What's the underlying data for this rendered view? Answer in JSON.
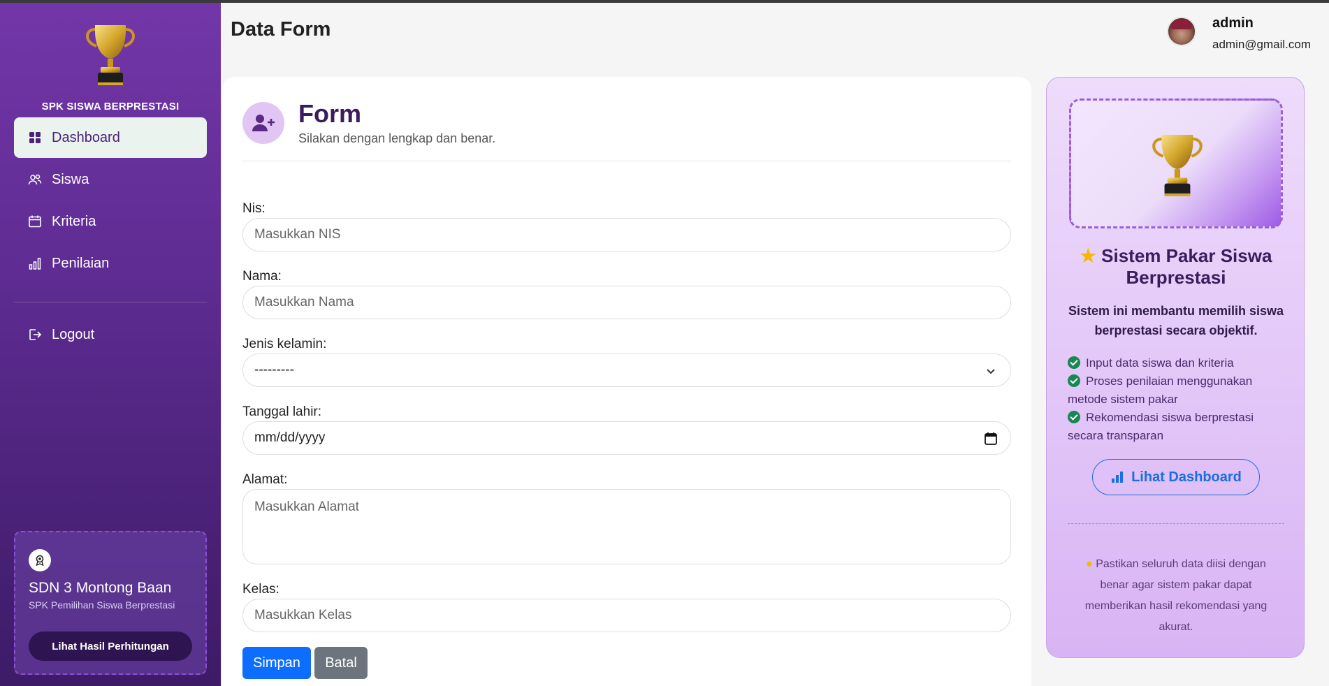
{
  "sidebar": {
    "brand_title": "SPK SISWA BERPRESTASI",
    "nav": [
      {
        "label": "Dashboard",
        "icon": "grid-icon",
        "active": true
      },
      {
        "label": "Siswa",
        "icon": "users-icon",
        "active": false
      },
      {
        "label": "Kriteria",
        "icon": "calendar-icon",
        "active": false
      },
      {
        "label": "Penilaian",
        "icon": "bar-chart-icon",
        "active": false
      },
      {
        "label": "Logout",
        "icon": "logout-icon",
        "active": false
      }
    ],
    "school_card": {
      "name_bold": "SDN 3",
      "name_rest": " Montong Baan",
      "subtitle": "SPK Pemilihan Siswa Berprestasi",
      "button_label": "Lihat Hasil Perhitungan"
    }
  },
  "header": {
    "page_title": "Data Form",
    "user_name": "admin",
    "user_email": "admin@gmail.com"
  },
  "form": {
    "heading": "Form",
    "subheading": "Silakan dengan lengkap dan benar.",
    "fields": {
      "nis": {
        "label": "Nis:",
        "placeholder": "Masukkan NIS"
      },
      "nama": {
        "label": "Nama:",
        "placeholder": "Masukkan Nama"
      },
      "jenis_kelamin": {
        "label": "Jenis kelamin:",
        "value": "---------"
      },
      "tanggal_lahir": {
        "label": "Tanggal lahir:",
        "value": "mm/dd/yyyy"
      },
      "alamat": {
        "label": "Alamat:",
        "placeholder": "Masukkan Alamat"
      },
      "kelas": {
        "label": "Kelas:",
        "placeholder": "Masukkan Kelas"
      }
    },
    "save_label": "Simpan",
    "cancel_label": "Batal"
  },
  "info_panel": {
    "title": "Sistem Pakar Siswa Berprestasi",
    "description": "Sistem ini membantu memilih siswa berprestasi secara objektif.",
    "features": [
      "Input data siswa dan kriteria",
      "Proses penilaian menggunakan metode sistem pakar",
      "Rekomendasi siswa berprestasi secara transparan"
    ],
    "button_label": "Lihat Dashboard",
    "note": "Pastikan seluruh data diisi dengan benar agar sistem pakar dapat memberikan hasil rekomendasi yang akurat."
  },
  "colors": {
    "sidebar_top": "#7336a8",
    "sidebar_bottom": "#3d1b66",
    "primary_button": "#0d6efd",
    "secondary_button": "#6c757d",
    "heading_purple": "#3b1c5c",
    "check_green": "#198754"
  }
}
